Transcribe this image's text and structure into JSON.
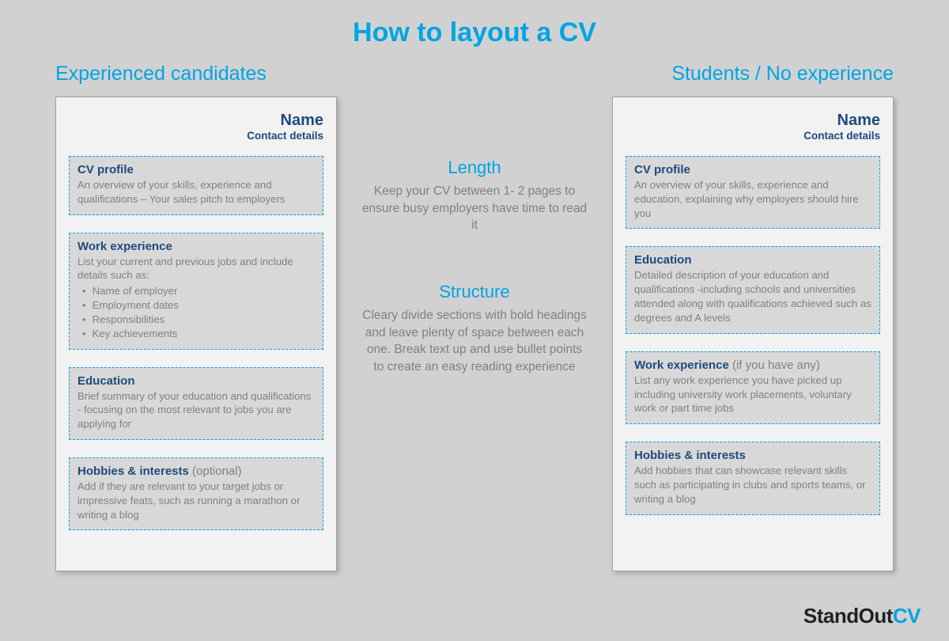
{
  "title": "How to layout a CV",
  "left": {
    "heading": "Experienced candidates",
    "name": "Name",
    "contact": "Contact details",
    "sections": [
      {
        "title": "CV profile",
        "optional": "",
        "body": "An overview of your skills, experience and qualifications – Your sales pitch to employers"
      },
      {
        "title": "Work experience",
        "optional": "",
        "body": "List your current and previous jobs and include details such as:",
        "bullets": [
          "Name of employer",
          "Employment dates",
          "Responsibilities",
          "Key achievements"
        ]
      },
      {
        "title": "Education",
        "optional": "",
        "body": "Brief summary of your education and qualifications - focusing on the most relevant to jobs you are applying for"
      },
      {
        "title": "Hobbies & interests",
        "optional": "(optional)",
        "body": "Add if they are relevant to your target jobs or impressive feats, such as running a marathon or writing a blog"
      }
    ]
  },
  "mid": {
    "length_h": "Length",
    "length_p": "Keep your CV between 1- 2 pages to ensure busy employers have time to read it",
    "structure_h": "Structure",
    "structure_p": "Cleary divide sections with bold headings and leave plenty of space between each one. Break text up and use bullet points to create an easy reading experience"
  },
  "right": {
    "heading": "Students / No experience",
    "name": "Name",
    "contact": "Contact details",
    "sections": [
      {
        "title": "CV profile",
        "optional": "",
        "body": "An overview of your skills, experience and education,  explaining why employers should hire you"
      },
      {
        "title": "Education",
        "optional": "",
        "body": "Detailed description of your education and qualifications  -including schools and universities attended along with qualifications achieved such as degrees and A levels"
      },
      {
        "title": "Work experience",
        "optional": "(if you have any)",
        "body": "List any work experience you have picked up including university work placements, voluntary work or part time jobs"
      },
      {
        "title": "Hobbies & interests",
        "optional": "",
        "body": "Add hobbies that can showcase relevant skills such as participating in clubs and sports teams, or writing a blog"
      }
    ]
  },
  "logo": {
    "a": "StandOut",
    "b": "CV"
  }
}
